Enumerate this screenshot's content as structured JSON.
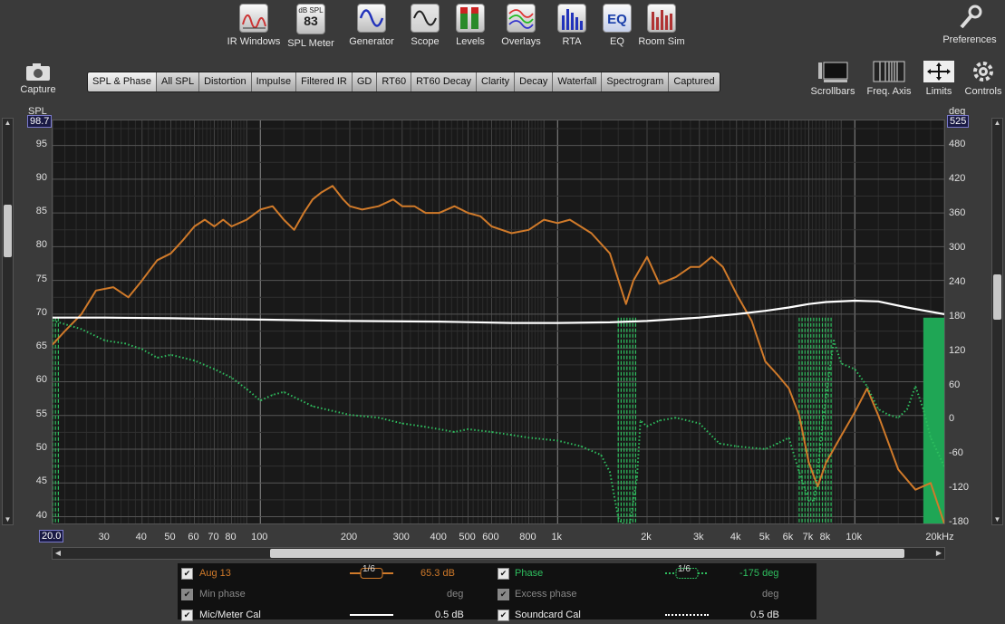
{
  "toolbar": {
    "items": [
      {
        "label": "IR Windows",
        "icon": "ir-windows-icon"
      },
      {
        "label": "SPL Meter",
        "icon": "spl-meter-icon",
        "unit": "dB SPL",
        "value": "83"
      },
      {
        "label": "Generator",
        "icon": "generator-icon"
      },
      {
        "label": "Scope",
        "icon": "scope-icon"
      },
      {
        "label": "Levels",
        "icon": "levels-icon"
      },
      {
        "label": "Overlays",
        "icon": "overlays-icon"
      },
      {
        "label": "RTA",
        "icon": "rta-icon"
      },
      {
        "label": "EQ",
        "icon": "eq-icon"
      },
      {
        "label": "Room Sim",
        "icon": "room-sim-icon"
      }
    ],
    "preferences": "Preferences",
    "capture": "Capture"
  },
  "tabs": [
    "SPL & Phase",
    "All SPL",
    "Distortion",
    "Impulse",
    "Filtered IR",
    "GD",
    "RT60",
    "RT60 Decay",
    "Clarity",
    "Decay",
    "Waterfall",
    "Spectrogram",
    "Captured"
  ],
  "active_tab": "SPL & Phase",
  "graph_controls": {
    "scrollbars": "Scrollbars",
    "freq_axis": "Freq. Axis",
    "limits": "Limits",
    "controls": "Controls"
  },
  "axes": {
    "left_label": "SPL",
    "left_top_value": "98.7",
    "left_ticks": [
      "95",
      "90",
      "85",
      "80",
      "75",
      "70",
      "65",
      "60",
      "55",
      "50",
      "45",
      "40"
    ],
    "right_label": "deg",
    "right_top_value": "525",
    "right_ticks": [
      "480",
      "420",
      "360",
      "300",
      "240",
      "180",
      "120",
      "60",
      "0",
      "-60",
      "-120",
      "-180"
    ],
    "x_start": "20.0",
    "x_ticks": [
      "30",
      "40",
      "50",
      "60",
      "70",
      "80",
      "100",
      "200",
      "300",
      "400",
      "500",
      "600",
      "800",
      "1k",
      "2k",
      "3k",
      "4k",
      "5k",
      "6k",
      "7k",
      "8k",
      "10k",
      "20kHz"
    ]
  },
  "legend": {
    "rows": [
      {
        "checked": true,
        "name": "Aug 13",
        "smoothing": "1/6",
        "value": "65.3 dB",
        "color": "#d07a2a",
        "name2": "Phase",
        "smoothing2": "1/6",
        "value2": "-175 deg",
        "color2": "#2fbf5f"
      },
      {
        "checked": true,
        "dim": true,
        "name": "Min phase",
        "value": "deg",
        "name2": "Excess phase",
        "value2": "deg"
      },
      {
        "checked": true,
        "name": "Mic/Meter Cal",
        "value": "0.5 dB",
        "name2": "Soundcard Cal",
        "value2": "0.5 dB"
      }
    ]
  },
  "chart_data": {
    "type": "line",
    "x_scale": "log",
    "xlim": [
      20,
      20000
    ],
    "ylim_left": [
      39,
      98.7
    ],
    "ylim_right": [
      -180,
      525
    ],
    "grid": true,
    "series": [
      {
        "name": "Aug 13",
        "axis": "left",
        "color": "#d07a2a",
        "x": [
          20,
          22,
          25,
          28,
          32,
          36,
          40,
          45,
          50,
          55,
          60,
          65,
          70,
          75,
          80,
          90,
          100,
          110,
          120,
          130,
          140,
          150,
          160,
          175,
          190,
          200,
          220,
          250,
          280,
          300,
          330,
          360,
          400,
          450,
          500,
          550,
          600,
          700,
          800,
          900,
          1000,
          1100,
          1300,
          1500,
          1700,
          1800,
          2000,
          2200,
          2500,
          2800,
          3000,
          3300,
          3600,
          4000,
          4500,
          5000,
          5500,
          6000,
          6500,
          7000,
          7500,
          8000,
          9000,
          10000,
          11000,
          12000,
          14000,
          16000,
          18000,
          20000
        ],
        "y": [
          65.5,
          67.5,
          70,
          73.5,
          74,
          72.5,
          75,
          78,
          79,
          81,
          83,
          84,
          83,
          84,
          83,
          84,
          85.5,
          86,
          84,
          82.5,
          85,
          87,
          88,
          89,
          87,
          86,
          85.5,
          86,
          87,
          86,
          86,
          85,
          85,
          86,
          85,
          84.5,
          83,
          82,
          82.5,
          84,
          83.5,
          84,
          82,
          79,
          71.5,
          75,
          78.5,
          74.5,
          75.5,
          77,
          77,
          78.5,
          77,
          73,
          69,
          63,
          61,
          59,
          55,
          48,
          44.5,
          48,
          52,
          55.5,
          59,
          55,
          47,
          44,
          45,
          39
        ]
      },
      {
        "name": "Phase",
        "axis": "right",
        "color": "#2fbf5f",
        "dotted": true,
        "x": [
          20,
          25,
          30,
          35,
          40,
          45,
          50,
          60,
          70,
          80,
          90,
          100,
          110,
          120,
          150,
          200,
          250,
          300,
          350,
          400,
          450,
          500,
          600,
          700,
          800,
          1000,
          1200,
          1400,
          1500,
          1600,
          1650,
          1750,
          1850,
          1900,
          2000,
          2200,
          2500,
          3000,
          3500,
          4000,
          5000,
          5500,
          6000,
          6500,
          7000,
          7300,
          7500,
          7800,
          8500,
          9000,
          10000,
          11000,
          12000,
          13000,
          14000,
          15000,
          16000,
          17000,
          18000,
          20000
        ],
        "y": [
          175,
          160,
          140,
          135,
          125,
          110,
          115,
          105,
          90,
          75,
          55,
          35,
          45,
          50,
          25,
          10,
          5,
          -5,
          -10,
          -15,
          -20,
          -15,
          -20,
          -25,
          -30,
          -35,
          -45,
          -60,
          -90,
          -170,
          -180,
          -180,
          -100,
          0,
          -10,
          0,
          5,
          -5,
          -40,
          -45,
          -50,
          -40,
          -30,
          -90,
          -140,
          -140,
          -90,
          0,
          140,
          100,
          90,
          60,
          20,
          10,
          5,
          20,
          60,
          20,
          -30,
          -80
        ]
      },
      {
        "name": "Mic/Meter Cal",
        "axis": "left",
        "color": "#ffffff",
        "x": [
          20,
          30,
          50,
          100,
          200,
          400,
          700,
          1000,
          1500,
          2000,
          3000,
          4000,
          5000,
          6000,
          7000,
          8000,
          10000,
          12000,
          15000,
          20000
        ],
        "y": [
          69.5,
          69.5,
          69.4,
          69.2,
          69.0,
          68.9,
          68.7,
          68.7,
          68.8,
          69.0,
          69.5,
          70.0,
          70.5,
          71.0,
          71.5,
          71.8,
          72.0,
          71.9,
          71.0,
          70.0
        ]
      }
    ],
    "phase_wrap_bands_hz": [
      [
        20,
        21
      ],
      [
        1600,
        1850
      ],
      [
        6500,
        8500
      ],
      [
        17000,
        20000
      ]
    ]
  }
}
